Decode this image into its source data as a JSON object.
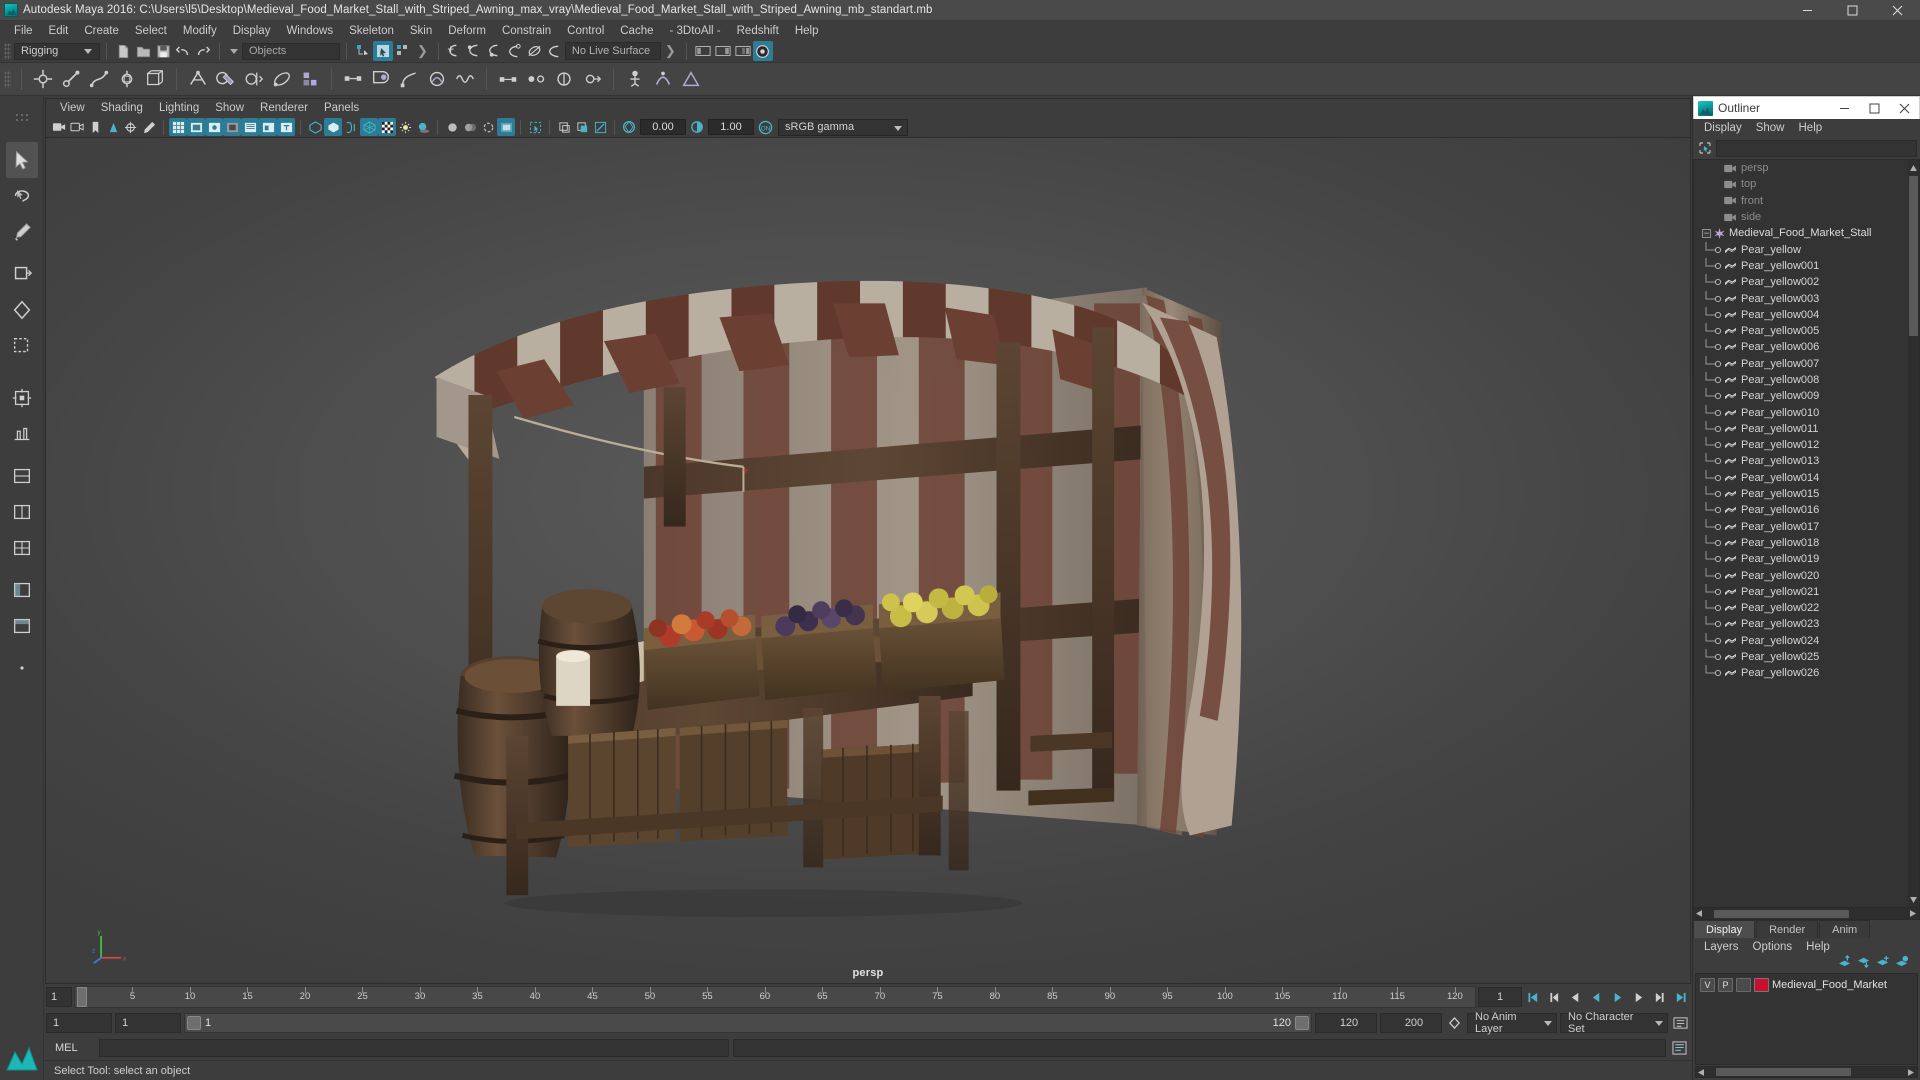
{
  "window": {
    "title": "Autodesk Maya 2016: C:\\Users\\l5\\Desktop\\Medieval_Food_Market_Stall_with_Striped_Awning_max_vray\\Medieval_Food_Market_Stall_with_Striped_Awning_mb_standart.mb",
    "app_icon": "maya-icon",
    "minimize": "–",
    "maximize": "□",
    "close": "✕"
  },
  "menubar": {
    "items": [
      "File",
      "Edit",
      "Create",
      "Select",
      "Modify",
      "Display",
      "Windows",
      "Skeleton",
      "Skin",
      "Deform",
      "Constrain",
      "Control",
      "Cache",
      "- 3DtoAll -",
      "Redshift",
      "Help"
    ]
  },
  "statusline": {
    "menuset": "Rigging",
    "selection_mask": "Objects",
    "live_surface": "No Live Surface"
  },
  "viewport_panel": {
    "menus": [
      "View",
      "Shading",
      "Lighting",
      "Show",
      "Renderer",
      "Panels"
    ],
    "exposure": "0.00",
    "gamma": "1.00",
    "color_management": "sRGB gamma",
    "camera_label": "persp",
    "axis": {
      "x": "x",
      "y": "y",
      "z": "z"
    }
  },
  "outliner": {
    "title": "Outliner",
    "menus": [
      "Display",
      "Show",
      "Help"
    ],
    "search_value": "",
    "root": {
      "label": "Medieval_Food_Market_Stall",
      "expander": "−"
    },
    "cameras": [
      "persp",
      "top",
      "front",
      "side"
    ],
    "children": [
      "Pear_yellow",
      "Pear_yellow001",
      "Pear_yellow002",
      "Pear_yellow003",
      "Pear_yellow004",
      "Pear_yellow005",
      "Pear_yellow006",
      "Pear_yellow007",
      "Pear_yellow008",
      "Pear_yellow009",
      "Pear_yellow010",
      "Pear_yellow011",
      "Pear_yellow012",
      "Pear_yellow013",
      "Pear_yellow014",
      "Pear_yellow015",
      "Pear_yellow016",
      "Pear_yellow017",
      "Pear_yellow018",
      "Pear_yellow019",
      "Pear_yellow020",
      "Pear_yellow021",
      "Pear_yellow022",
      "Pear_yellow023",
      "Pear_yellow024",
      "Pear_yellow025",
      "Pear_yellow026"
    ]
  },
  "layer_editor": {
    "tabs": [
      "Display",
      "Render",
      "Anim"
    ],
    "active_tab": "Display",
    "menus": [
      "Layers",
      "Options",
      "Help"
    ],
    "layers": [
      {
        "visible": "V",
        "playback": "P",
        "third": "",
        "color": "#c8102e",
        "name": "Medieval_Food_Market"
      }
    ]
  },
  "time_slider": {
    "current_frame": "1",
    "ticks": [
      "5",
      "10",
      "15",
      "20",
      "25",
      "30",
      "35",
      "40",
      "45",
      "50",
      "55",
      "60",
      "65",
      "70",
      "75",
      "80",
      "85",
      "90",
      "95",
      "100",
      "105",
      "110",
      "115",
      "120"
    ],
    "frame_field": "1"
  },
  "range_slider": {
    "anim_start": "1",
    "range_start": "1",
    "bar_left": "1",
    "bar_right": "120",
    "range_end": "120",
    "anim_end": "200",
    "anim_layer": "No Anim Layer",
    "character_set": "No Character Set"
  },
  "command_line": {
    "label": "MEL",
    "input_value": "",
    "output_value": ""
  },
  "help_line": {
    "text": "Select Tool: select an object"
  },
  "colors": {
    "accent": "#2b7c94",
    "panel_bg": "#3d3d3d",
    "field_bg": "#333333",
    "layer_color": "#c8102e"
  }
}
